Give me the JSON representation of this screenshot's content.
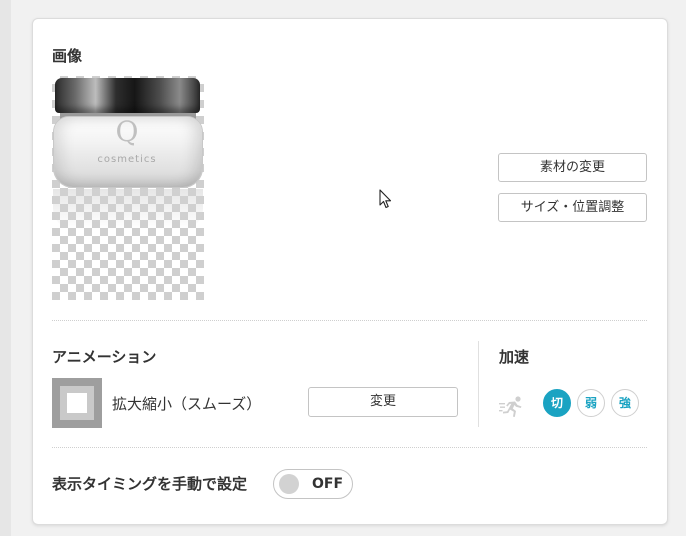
{
  "image_section": {
    "title": "画像",
    "product": {
      "logo_letter": "Q",
      "logo_text": "cosmetics"
    },
    "change_button": "素材の変更",
    "resize_button": "サイズ・位置調整"
  },
  "animation_section": {
    "title": "アニメーション",
    "current_animation": "拡大縮小（スムーズ）",
    "change_button": "変更"
  },
  "acceleration_section": {
    "title": "加速",
    "icon": "runner-icon",
    "options": [
      {
        "label": "切",
        "selected": true
      },
      {
        "label": "弱",
        "selected": false
      },
      {
        "label": "強",
        "selected": false
      }
    ]
  },
  "timing_section": {
    "title": "表示タイミングを手動で設定",
    "toggle_label": "OFF",
    "toggle_on": false
  },
  "colors": {
    "accent": "#1aa3c2",
    "card_background": "#ffffff",
    "page_background": "#f1f1f1"
  }
}
